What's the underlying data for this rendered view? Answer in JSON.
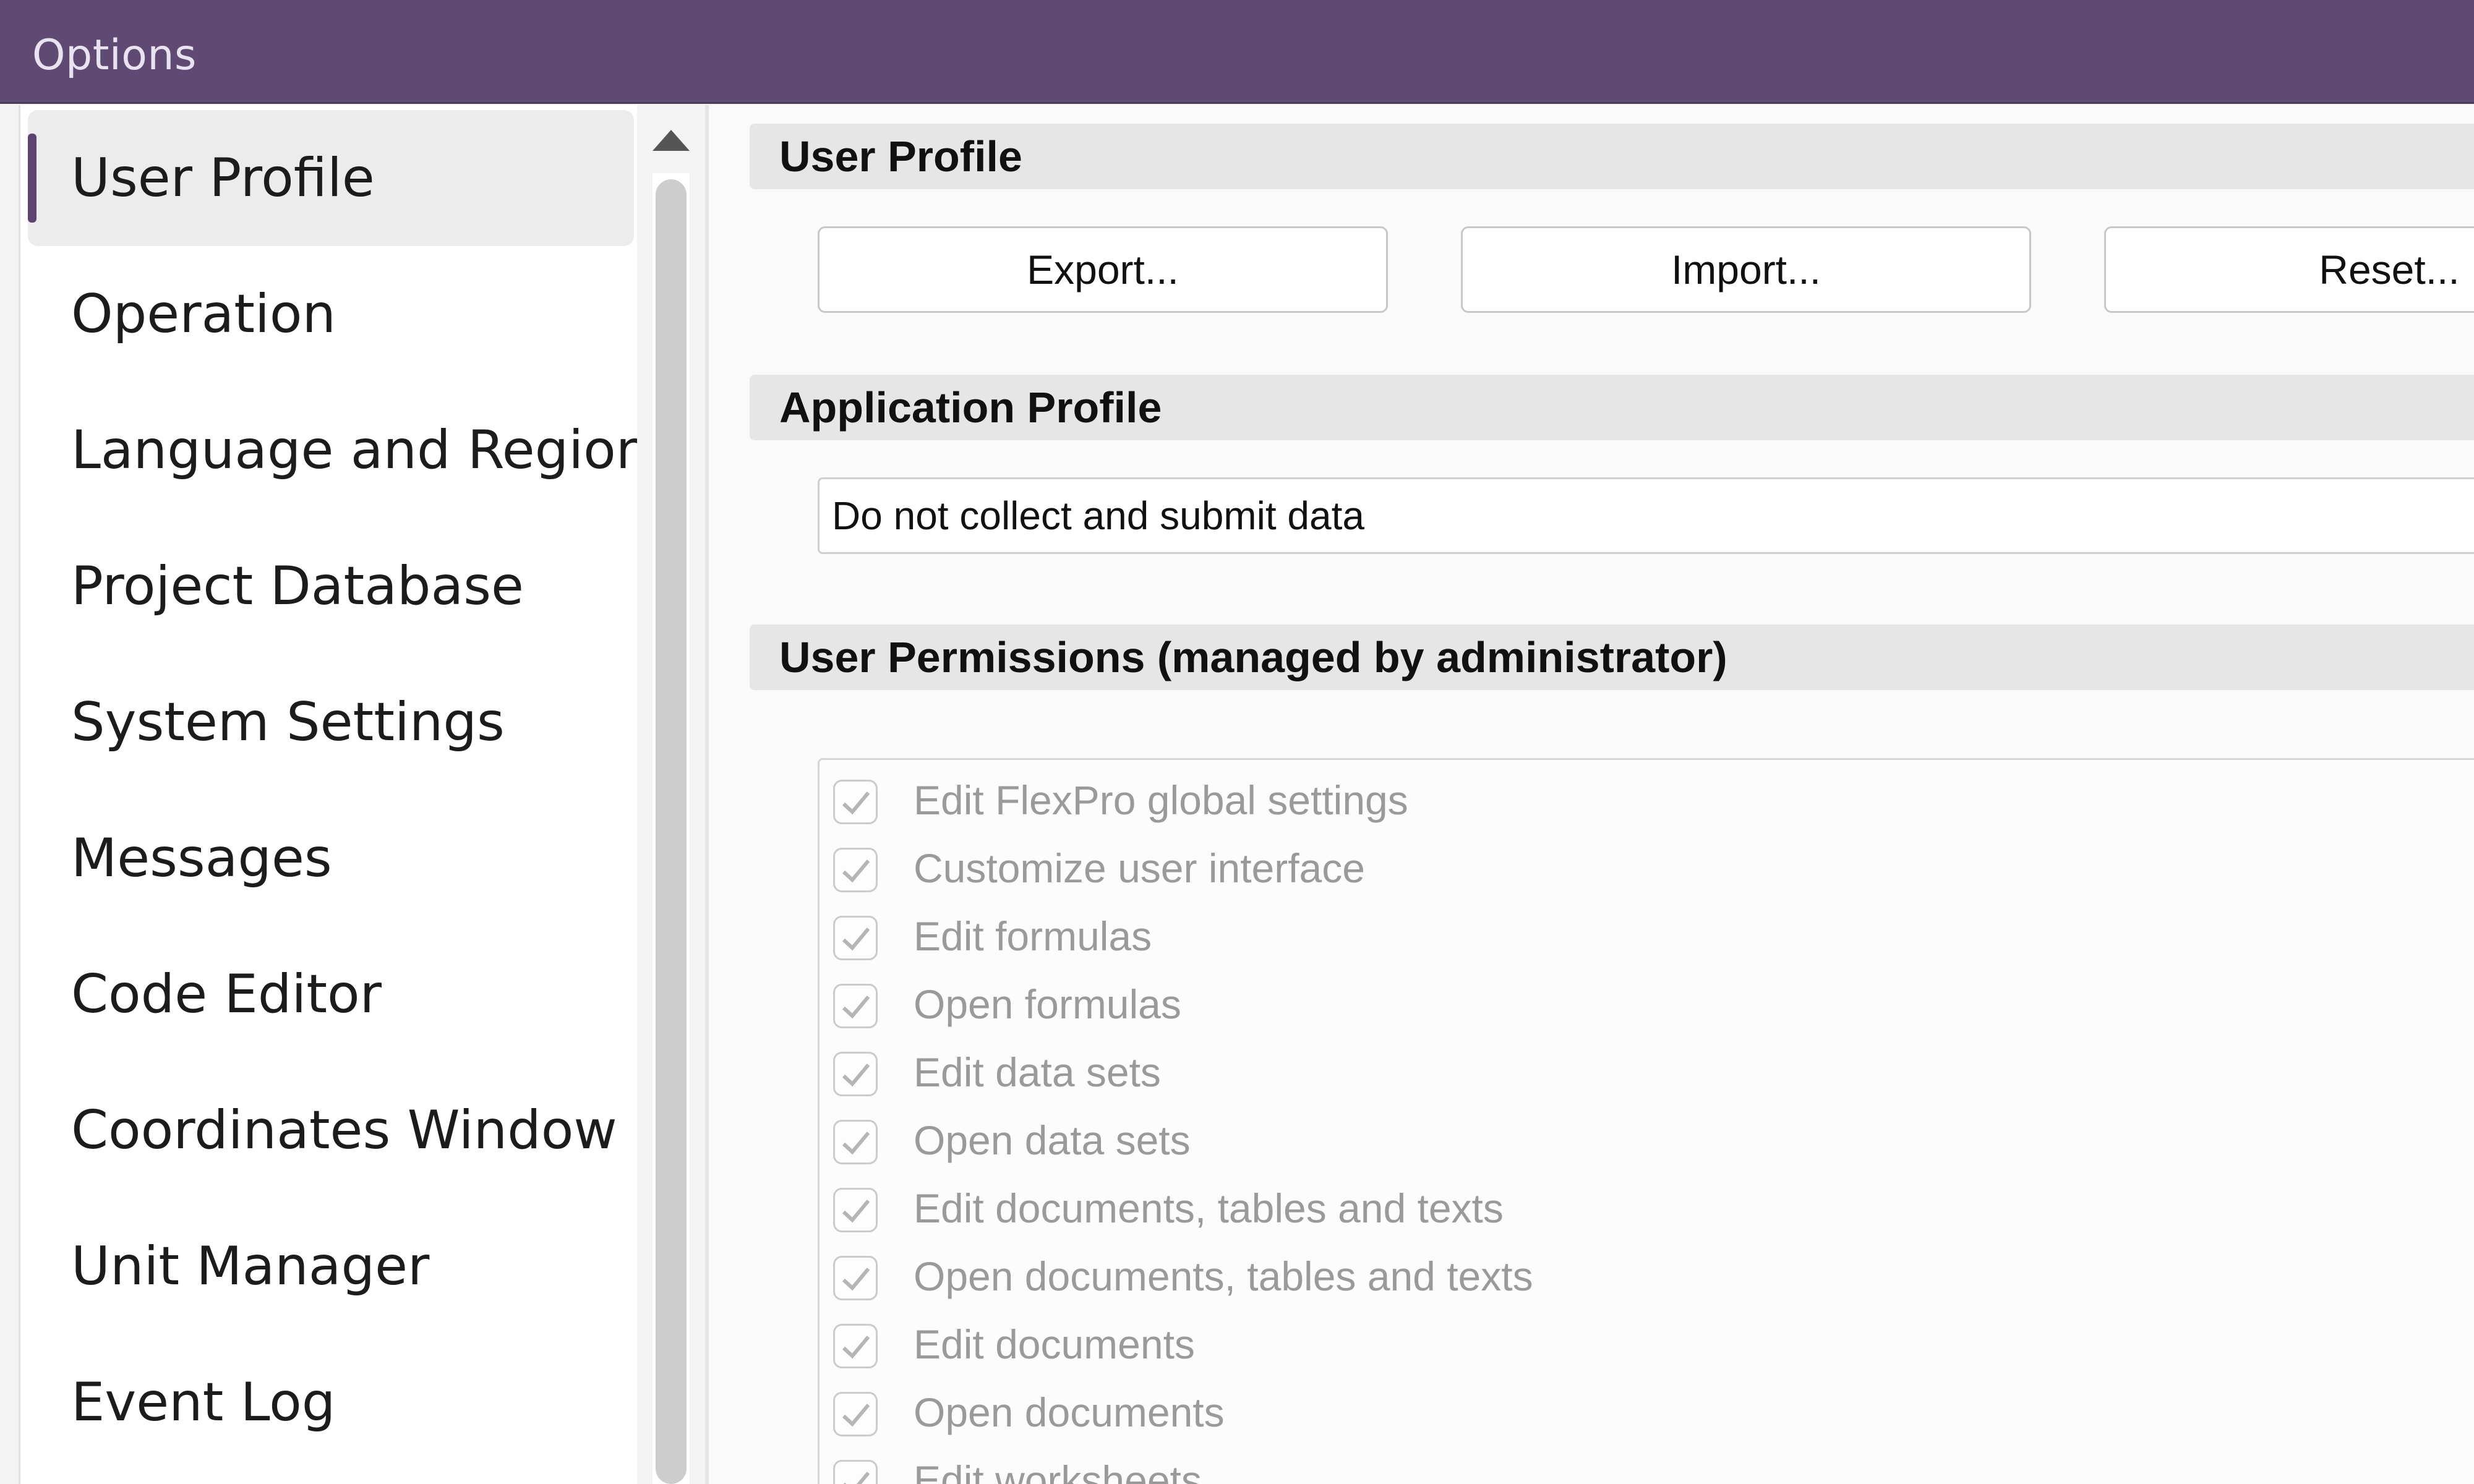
{
  "window": {
    "title": "Options"
  },
  "sidebar": {
    "items": [
      {
        "label": "User Profile"
      },
      {
        "label": "Operation"
      },
      {
        "label": "Language and Region"
      },
      {
        "label": "Project Database"
      },
      {
        "label": "System Settings"
      },
      {
        "label": "Messages"
      },
      {
        "label": "Code Editor"
      },
      {
        "label": "Coordinates Window"
      },
      {
        "label": "Unit Manager"
      },
      {
        "label": "Event Log"
      }
    ],
    "active_index": 0
  },
  "user_profile": {
    "header": "User Profile",
    "export_label": "Export...",
    "import_label": "Import...",
    "reset_label": "Reset..."
  },
  "application_profile": {
    "header": "Application Profile",
    "selected": "Do not collect and submit data"
  },
  "permissions": {
    "header": "User Permissions (managed by administrator)",
    "items": [
      {
        "label": "Edit FlexPro global settings",
        "checked": true
      },
      {
        "label": "Customize user interface",
        "checked": true
      },
      {
        "label": "Edit formulas",
        "checked": true
      },
      {
        "label": "Open formulas",
        "checked": true
      },
      {
        "label": "Edit data sets",
        "checked": true
      },
      {
        "label": "Open data sets",
        "checked": true
      },
      {
        "label": "Edit documents, tables and texts",
        "checked": true
      },
      {
        "label": "Open documents, tables and texts",
        "checked": true
      },
      {
        "label": "Edit documents",
        "checked": true
      },
      {
        "label": "Open documents",
        "checked": true
      },
      {
        "label": "Edit worksheets",
        "checked": true
      }
    ]
  },
  "colors": {
    "titlebar": "#5e4a73",
    "accent": "#5b4570",
    "disabled_text": "#9a9a9a"
  }
}
